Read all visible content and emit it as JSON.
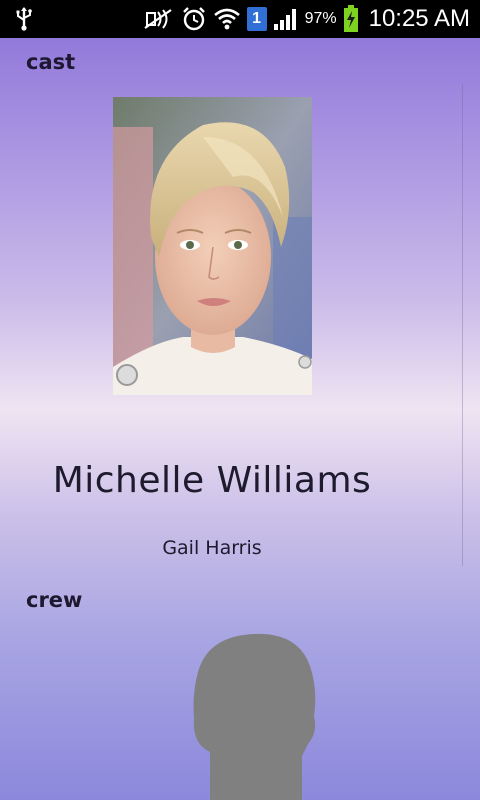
{
  "status_bar": {
    "battery_percent": "97%",
    "time": "10:25 AM",
    "notification_badge": "1",
    "icons": [
      "usb-icon",
      "mute-icon",
      "alarm-icon",
      "wifi-icon",
      "signal-icon",
      "battery-icon"
    ]
  },
  "cast": {
    "label": "cast",
    "person": {
      "name": "Michelle Williams",
      "role": "Gail Harris"
    }
  },
  "crew": {
    "label": "crew"
  },
  "colors": {
    "background_top": "#8a70d8",
    "background_mid": "#efe4f2",
    "background_bottom": "#8c88dc",
    "text": "#1e1b2e"
  }
}
